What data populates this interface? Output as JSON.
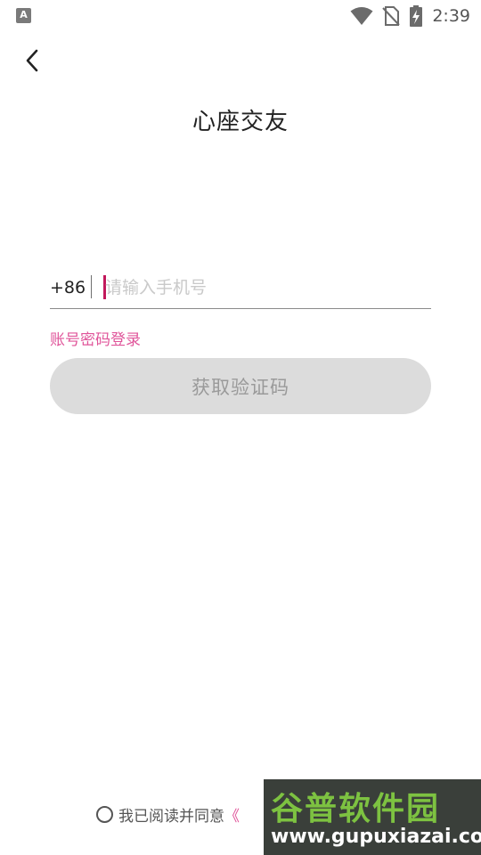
{
  "status_bar": {
    "left_icon_letter": "A",
    "time": "2:39"
  },
  "header": {
    "title": "心座交友"
  },
  "phone_form": {
    "country_code": "+86",
    "placeholder": "请输入手机号",
    "value": ""
  },
  "pwd_login_label": "账号密码登录",
  "get_code_label": "获取验证码",
  "agreement": {
    "checked": false,
    "text": "我已阅读并同意",
    "link_visible": "《"
  },
  "watermark": {
    "title": "谷普软件园",
    "url": "www.gupuxiazai.com"
  },
  "colors": {
    "accent": "#e0559a",
    "caret": "#c2185b",
    "button_bg": "#dcdcdc",
    "button_text": "#9a9a9a"
  }
}
